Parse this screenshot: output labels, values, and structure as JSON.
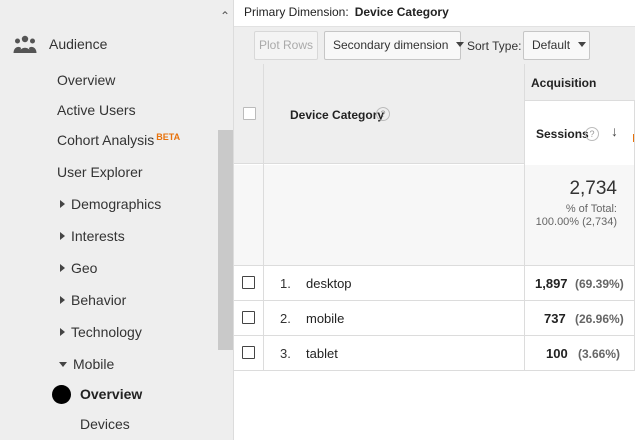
{
  "sidebar": {
    "section_label": "Audience",
    "items": [
      {
        "label": "Overview"
      },
      {
        "label": "Active Users"
      },
      {
        "label": "Cohort Analysis",
        "badge": "BETA"
      },
      {
        "label": "User Explorer"
      },
      {
        "label": "Demographics"
      },
      {
        "label": "Interests"
      },
      {
        "label": "Geo"
      },
      {
        "label": "Behavior"
      },
      {
        "label": "Technology"
      },
      {
        "label": "Mobile"
      }
    ],
    "sub_items": [
      {
        "label": "Overview",
        "active": true
      },
      {
        "label": "Devices"
      }
    ]
  },
  "primary_dimension": {
    "label": "Primary Dimension:",
    "value": "Device Category"
  },
  "toolbar": {
    "plot_rows": "Plot Rows",
    "secondary_dimension": "Secondary dimension",
    "sort_type_label": "Sort Type:",
    "sort_type_value": "Default"
  },
  "table": {
    "group_header": "Acquisition",
    "dimension_header": "Device Category",
    "metric_header": "Sessions",
    "help_glyph": "?",
    "sort_glyph": "↓",
    "total": {
      "value": "2,734",
      "pct_label": "% of Total:",
      "pct": "100.00% (2,734)"
    },
    "rows": [
      {
        "index": "1.",
        "name": "desktop",
        "value": "1,897",
        "pct": "(69.39%)"
      },
      {
        "index": "2.",
        "name": "mobile",
        "value": "737",
        "pct": "(26.96%)"
      },
      {
        "index": "3.",
        "name": "tablet",
        "value": "100",
        "pct": "(3.66%)"
      }
    ]
  },
  "colors": {
    "accent_orange": "#e8710a",
    "sidebar_bg": "#eeeeee"
  }
}
